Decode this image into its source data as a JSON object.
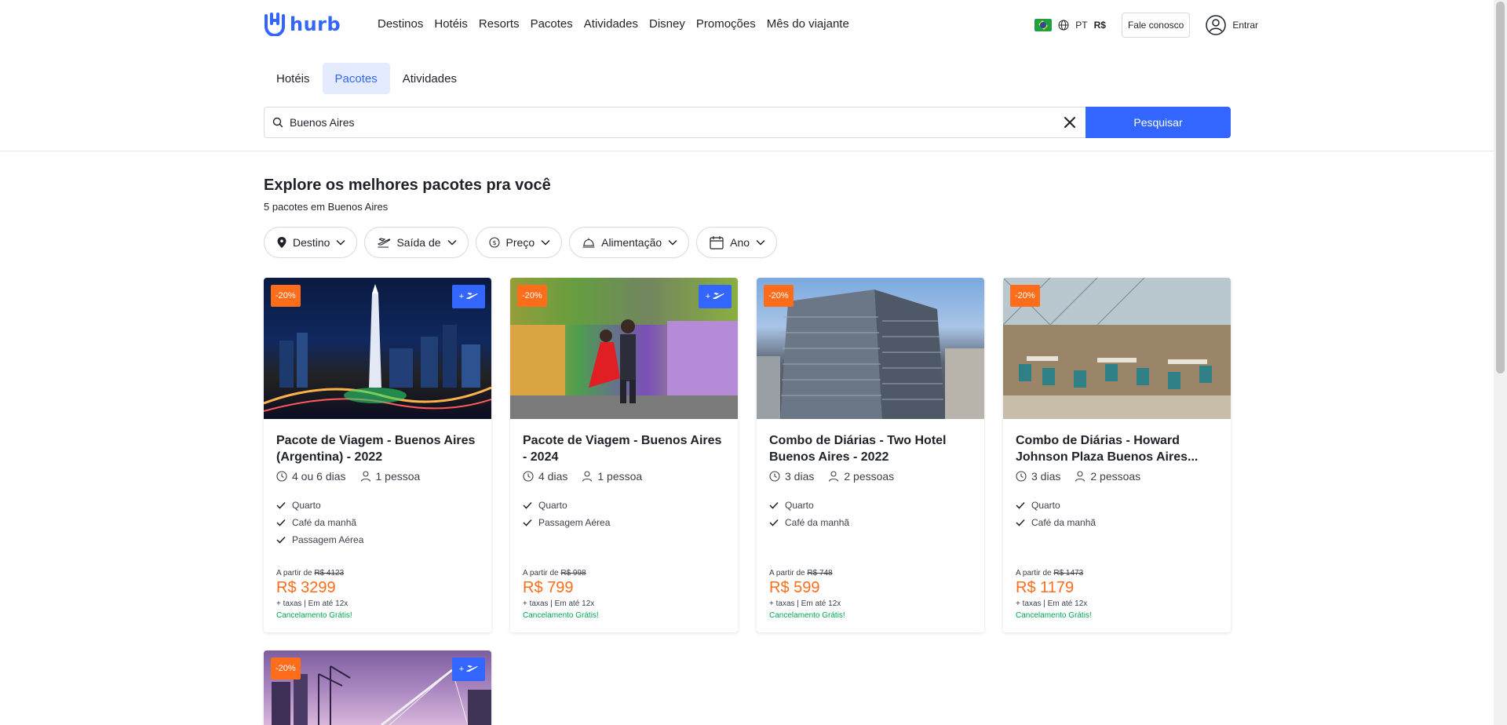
{
  "header": {
    "logo_text": "hurb",
    "nav": [
      "Destinos",
      "Hotéis",
      "Resorts",
      "Pacotes",
      "Atividades",
      "Disney",
      "Promoções",
      "Mês do viajante"
    ],
    "lang": "PT",
    "currency": "R$",
    "contact_label": "Fale conosco",
    "login_label": "Entrar"
  },
  "tabs": [
    {
      "label": "Hotéis",
      "active": false
    },
    {
      "label": "Pacotes",
      "active": true
    },
    {
      "label": "Atividades",
      "active": false
    }
  ],
  "search": {
    "value": "Buenos Aires",
    "button_label": "Pesquisar"
  },
  "results": {
    "heading": "Explore os melhores pacotes pra você",
    "count_text": "5 pacotes em Buenos Aires"
  },
  "filters": [
    {
      "label": "Destino",
      "icon": "location-pin-icon"
    },
    {
      "label": "Saída de",
      "icon": "plane-departure-icon"
    },
    {
      "label": "Preço",
      "icon": "price-tag-icon"
    },
    {
      "label": "Alimentação",
      "icon": "food-icon"
    },
    {
      "label": "Ano",
      "icon": "calendar-icon"
    }
  ],
  "cards": [
    {
      "discount": "-20%",
      "has_flight": true,
      "flight_label": "+",
      "title": "Pacote de Viagem - Buenos Aires (Argentina) - 2022",
      "duration": "4 ou 6 dias",
      "people": "1 pessoa",
      "features": [
        "Quarto",
        "Café da manhã",
        "Passagem Aérea"
      ],
      "from_label": "A partir de",
      "old_price": "R$ 4123",
      "price": "R$ 3299",
      "taxes": "+ taxas | Em até 12x",
      "cancel": "Cancelamento Grátis!"
    },
    {
      "discount": "-20%",
      "has_flight": true,
      "flight_label": "+",
      "title": "Pacote de Viagem - Buenos Aires - 2024",
      "duration": "4 dias",
      "people": "1 pessoa",
      "features": [
        "Quarto",
        "Passagem Aérea"
      ],
      "from_label": "A partir de",
      "old_price": "R$ 998",
      "price": "R$ 799",
      "taxes": "+ taxas | Em até 12x",
      "cancel": "Cancelamento Grátis!"
    },
    {
      "discount": "-20%",
      "has_flight": false,
      "title": "Combo de Diárias - Two Hotel Buenos Aires - 2022",
      "duration": "3 dias",
      "people": "2 pessoas",
      "features": [
        "Quarto",
        "Café da manhã"
      ],
      "from_label": "A partir de",
      "old_price": "R$ 748",
      "price": "R$ 599",
      "taxes": "+ taxas | Em até 12x",
      "cancel": "Cancelamento Grátis!"
    },
    {
      "discount": "-20%",
      "has_flight": false,
      "title": "Combo de Diárias - Howard Johnson Plaza Buenos Aires...",
      "duration": "3 dias",
      "people": "2 pessoas",
      "features": [
        "Quarto",
        "Café da manhã"
      ],
      "from_label": "A partir de",
      "old_price": "R$ 1473",
      "price": "R$ 1179",
      "taxes": "+ taxas | Em até 12x",
      "cancel": "Cancelamento Grátis!"
    },
    {
      "discount": "-20%",
      "has_flight": true,
      "flight_label": "+"
    }
  ],
  "colors": {
    "brand": "#3366ff",
    "discount": "#ff6c1a",
    "price": "#ff6c1a",
    "cancel": "#00a651"
  }
}
